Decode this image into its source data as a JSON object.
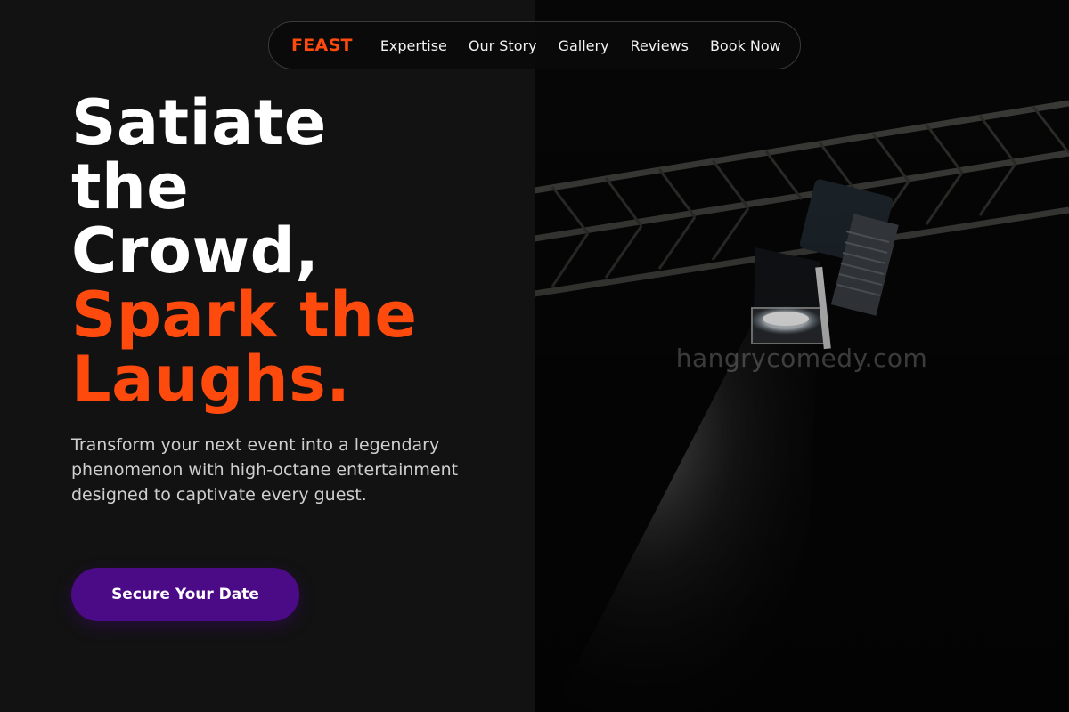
{
  "nav": {
    "logo": "FEAST",
    "links": [
      "Expertise",
      "Our Story",
      "Gallery",
      "Reviews",
      "Book Now"
    ]
  },
  "hero": {
    "title_lines": [
      "Satiate",
      "the",
      "Crowd,"
    ],
    "accent_lines": [
      "Spark the",
      "Laughs."
    ],
    "subtitle": "Transform your next event into a legendary phenomenon with high-octane entertainment designed to captivate every guest.",
    "cta_label": "Secure Your Date"
  },
  "image": {
    "watermark": "hangrycomedy.com",
    "subject": "stage spotlight on truss"
  },
  "colors": {
    "background": "#121212",
    "accent": "#ff4a0d",
    "cta": "#4b0a86",
    "text": "#ffffff"
  }
}
